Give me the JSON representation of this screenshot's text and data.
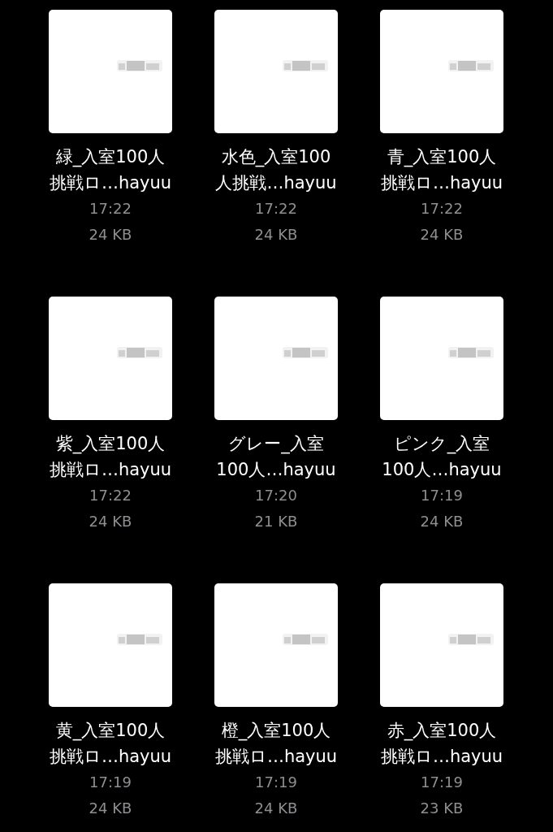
{
  "files": [
    {
      "name_lines": [
        "緑_入室100人",
        "挑戦ロ…hayuu"
      ],
      "time": "17:22",
      "size": "24 KB"
    },
    {
      "name_lines": [
        "水色_入室100",
        "人挑戦…hayuu"
      ],
      "time": "17:22",
      "size": "24 KB"
    },
    {
      "name_lines": [
        "青_入室100人",
        "挑戦ロ…hayuu"
      ],
      "time": "17:22",
      "size": "24 KB"
    },
    {
      "name_lines": [
        "紫_入室100人",
        "挑戦ロ…hayuu"
      ],
      "time": "17:22",
      "size": "24 KB"
    },
    {
      "name_lines": [
        "グレー_入室",
        "100人…hayuu"
      ],
      "time": "17:20",
      "size": "21 KB"
    },
    {
      "name_lines": [
        "ピンク_入室",
        "100人…hayuu"
      ],
      "time": "17:19",
      "size": "24 KB"
    },
    {
      "name_lines": [
        "黄_入室100人",
        "挑戦ロ…hayuu"
      ],
      "time": "17:19",
      "size": "24 KB"
    },
    {
      "name_lines": [
        "橙_入室100人",
        "挑戦ロ…hayuu"
      ],
      "time": "17:19",
      "size": "24 KB"
    },
    {
      "name_lines": [
        "赤_入室100人",
        "挑戦ロ…hayuu"
      ],
      "time": "17:19",
      "size": "23 KB"
    }
  ]
}
